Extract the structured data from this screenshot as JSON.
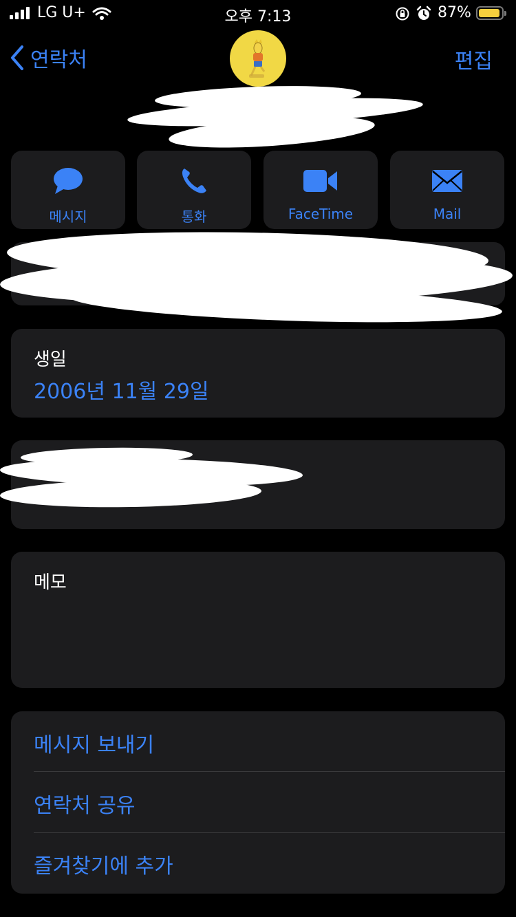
{
  "status_bar": {
    "carrier": "LG U+",
    "time": "오후 7:13",
    "battery_percent": "87%"
  },
  "nav": {
    "back_label": "연락처",
    "edit_label": "편집"
  },
  "actions": [
    {
      "label": "메시지",
      "icon": "message-bubble-icon"
    },
    {
      "label": "통화",
      "icon": "phone-icon"
    },
    {
      "label": "FaceTime",
      "icon": "video-camera-icon"
    },
    {
      "label": "Mail",
      "icon": "envelope-icon"
    }
  ],
  "birthday": {
    "label": "생일",
    "value": "2006년 11월 29일"
  },
  "memo": {
    "label": "메모"
  },
  "options": [
    "메시지 보내기",
    "연락처 공유",
    "즐겨찾기에 추가"
  ],
  "colors": {
    "accent": "#3b82f6",
    "card_background": "#1c1c1e",
    "background": "#000000",
    "avatar_background": "#f1d845"
  }
}
